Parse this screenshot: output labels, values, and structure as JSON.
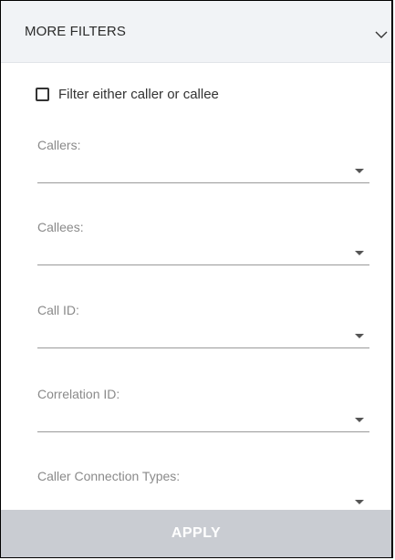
{
  "header": {
    "title": "MORE FILTERS",
    "toggle_icon": "chevron-down-icon"
  },
  "checkbox": {
    "label": "Filter either caller or callee",
    "checked": false
  },
  "fields": [
    {
      "label": "Callers:",
      "value": ""
    },
    {
      "label": "Callees:",
      "value": ""
    },
    {
      "label": "Call ID:",
      "value": ""
    },
    {
      "label": "Correlation ID:",
      "value": ""
    },
    {
      "label": "Caller Connection Types:",
      "value": ""
    }
  ],
  "apply": {
    "label": "APPLY",
    "background": "#c9ccd2",
    "text_color": "#ffffff"
  },
  "colors": {
    "header_bg": "#f1f3f6",
    "field_label": "#8a8a8a",
    "underline": "#9a9a9a"
  }
}
